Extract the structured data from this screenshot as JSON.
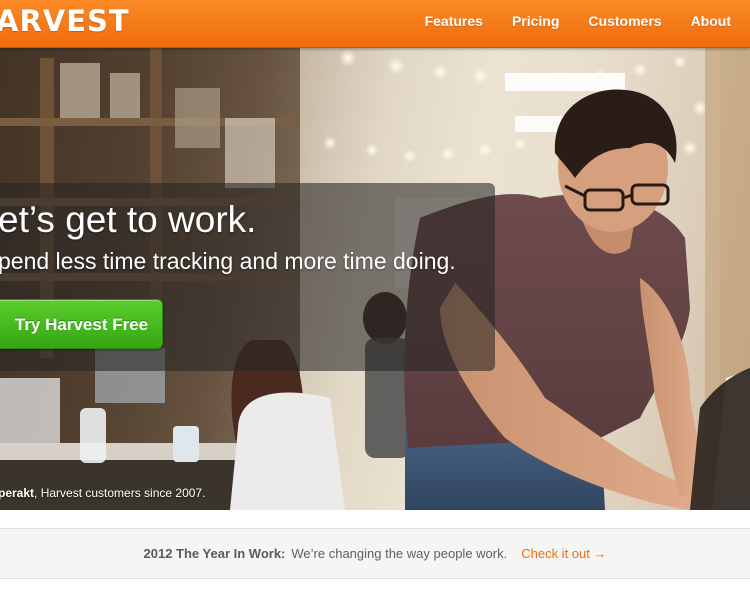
{
  "brand": {
    "logo_text": "ARVEST",
    "accent": "#f47b20"
  },
  "nav": [
    {
      "label": "Features"
    },
    {
      "label": "Pricing"
    },
    {
      "label": "Customers"
    },
    {
      "label": "About"
    }
  ],
  "hero": {
    "headline": "et’s get to work.",
    "subline": "pend less time tracking and more time doing.",
    "cta_label": "Try Harvest Free",
    "caption_bold": "perakt",
    "caption_rest": ", Harvest customers since 2007."
  },
  "announcement": {
    "lead": "2012 The Year In Work:",
    "text": "We’re changing the way people work.",
    "link_label": "Check it out →"
  },
  "colors": {
    "topbar": "#f47b20",
    "cta": "#46b81d",
    "link": "#f06d12"
  }
}
